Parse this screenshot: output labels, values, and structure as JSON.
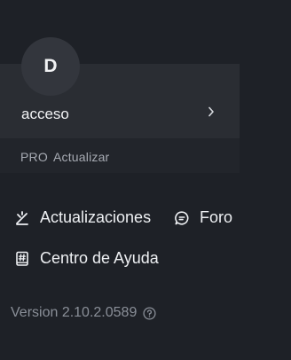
{
  "account": {
    "avatar_letter": "D",
    "name": "acceso"
  },
  "pro": {
    "badge": "PRO",
    "upgrade_label": "Actualizar"
  },
  "links": {
    "updates_label": "Actualizaciones",
    "forum_label": "Foro",
    "help_label": "Centro de Ayuda"
  },
  "version": {
    "text": "Version 2.10.2.0589"
  },
  "icons": {
    "updates": "sparkle-arrow-icon",
    "forum": "chat-bubble-icon",
    "help": "hash-book-icon",
    "version_info": "help-circle-icon",
    "account_chevron": "chevron-right-icon"
  },
  "colors": {
    "background": "#1e2127",
    "card": "#2a2d33",
    "pro_bar": "#22252b",
    "avatar": "#33363d",
    "text_primary": "#eef0f3",
    "text_muted": "#8a8f98"
  }
}
